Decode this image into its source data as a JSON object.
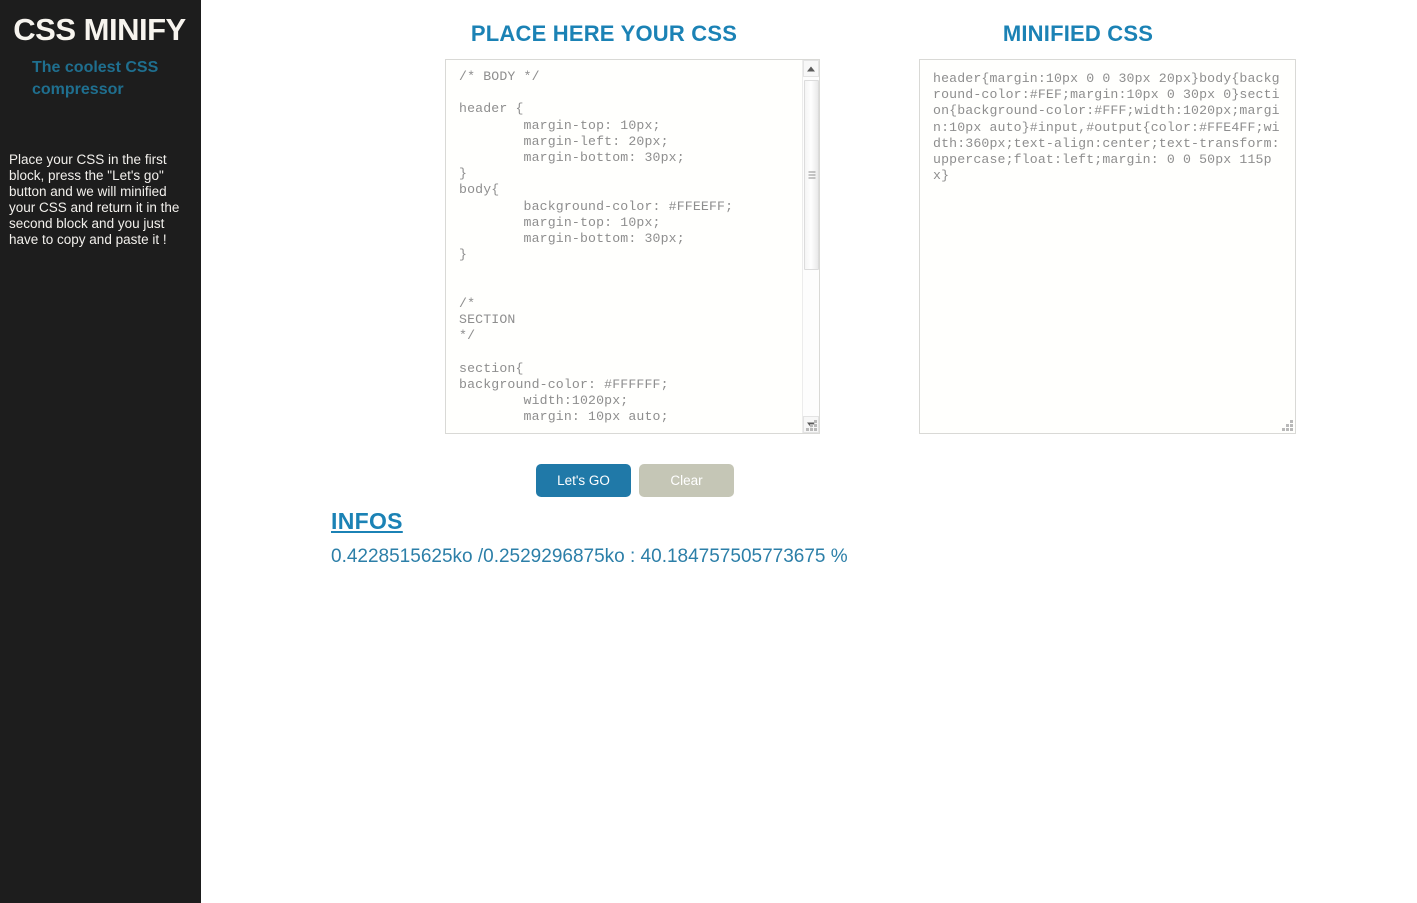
{
  "sidebar": {
    "title": "CSS MINIFY",
    "subtitle": "The coolest CSS compressor",
    "description": "Place your CSS in the first block, press the \"Let's go\" button and we will minified your CSS and return it in the second block and you just have to copy and paste it !",
    "background_color": "#1d1d1d",
    "subtitle_color": "#1f6f8f"
  },
  "main": {
    "input_panel": {
      "heading": "PLACE HERE YOUR CSS",
      "textarea_value": "/* BODY */\n\nheader {\n        margin-top: 10px;\n        margin-left: 20px;\n        margin-bottom: 30px;\n}\nbody{\n        background-color: #FFEEFF;\n        margin-top: 10px;\n        margin-bottom: 30px;\n}\n\n\n/*\nSECTION\n*/\n\nsection{\nbackground-color: #FFFFFF;\n        width:1020px;\n        margin: 10px auto;",
      "placeholder": ""
    },
    "output_panel": {
      "heading": "MINIFIED CSS",
      "textarea_value": "header{margin:10px 0 0 30px 20px}body{background-color:#FEF;margin:10px 0 30px 0}section{background-color:#FFF;width:1020px;margin:10px auto}#input,#output{color:#FFE4FF;width:360px;text-align:center;text-transform:uppercase;float:left;margin: 0 0 50px 115px}",
      "placeholder": ""
    },
    "buttons": {
      "go_label": "Let's GO",
      "go_color": "#2079a8",
      "clear_label": "Clear",
      "clear_color": "#c5c6b6"
    },
    "infos": {
      "title": "INFOS",
      "value": "0.4228515625ko /0.2529296875ko : 40.184757505773675 %",
      "accent_color": "#1b82b5"
    },
    "heading_color": "#1b82b5"
  }
}
